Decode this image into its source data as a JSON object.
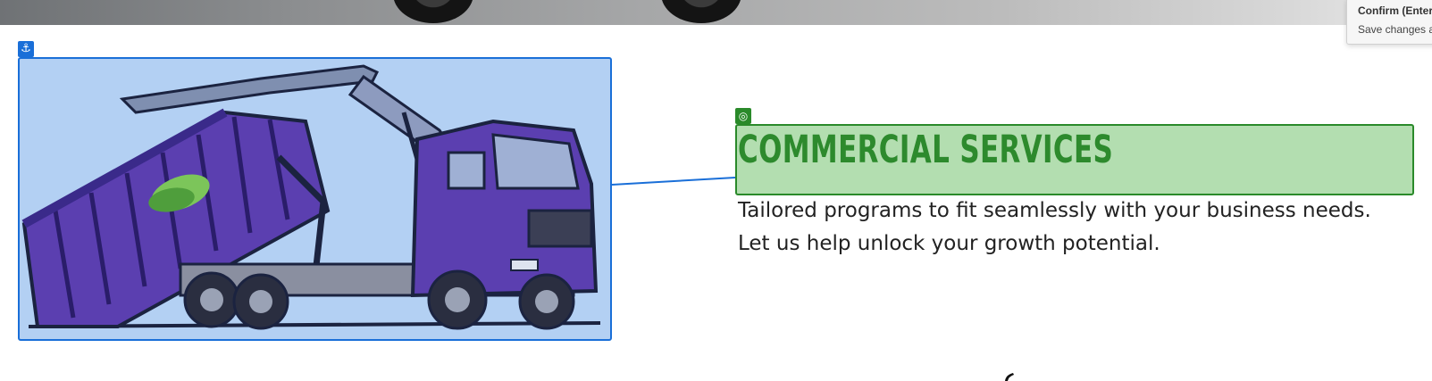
{
  "hero": {
    "image": "truck-tyres-photo"
  },
  "image_block": {
    "anchor_icon": "anchor-icon",
    "illustration": "hook-lift-truck-illustration",
    "colors": {
      "frame": "#1a6fd8",
      "background": "#b3d0f3",
      "truck": "#5b3fb0",
      "leaf": "#7cc55a"
    }
  },
  "text_block": {
    "target_icon": "target-icon",
    "heading": "COMMERCIAL SERVICES",
    "body_line_1": "Tailored programs to fit seamlessly with your business needs.",
    "body_line_2": "Let us help unlock your growth potential.",
    "colors": {
      "frame": "#2a8a2a",
      "highlight": "#b3deb0",
      "heading": "#2d8a2d"
    }
  },
  "toast": {
    "title": "Confirm (Enter",
    "subtitle": "Save changes ar"
  }
}
